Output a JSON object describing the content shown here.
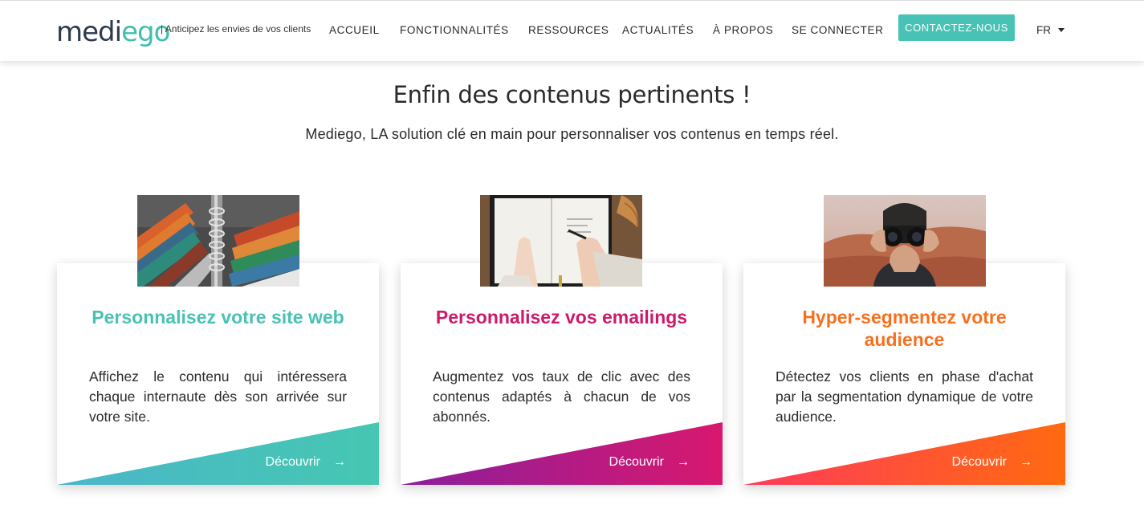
{
  "header": {
    "logo_part1": "medi",
    "logo_part2": "ego",
    "tagline": "| Anticipez les envies de vos clients",
    "nav": [
      "ACCUEIL",
      "FONCTIONNALITÉS",
      "RESSOURCES",
      "ACTUALITÉS",
      "À PROPOS",
      "SE CONNECTER"
    ],
    "contact_label": "CONTACTEZ-NOUS",
    "lang_label": "FR"
  },
  "hero": {
    "title": "Enfin des contenus pertinents !",
    "subtitle": "Mediego, LA solution clé en main pour personnaliser vos contenus en temps réel."
  },
  "cards": [
    {
      "title": "Personnalisez votre site web",
      "text": "Affichez le contenu qui intéressera chaque internaute dès son arrivée sur votre site.",
      "link": "Découvrir",
      "arrow": "→",
      "accent": "#48c2b4"
    },
    {
      "title": "Personnalisez vos emailings",
      "text": "Augmentez vos taux de clic avec des contenus adaptés à chacun de vos abonnés.",
      "link": "Découvrir",
      "arrow": "→",
      "accent": "#cc1a6a"
    },
    {
      "title": "Hyper-segmentez votre audience",
      "text": "Détectez vos clients en phase d'achat par la segmentation dynamique de votre audience.",
      "link": "Découvrir",
      "arrow": "→",
      "accent": "#f7701d"
    }
  ],
  "colors": {
    "brand_dark": "#2d3a4f",
    "brand_teal": "#48c2b4"
  }
}
